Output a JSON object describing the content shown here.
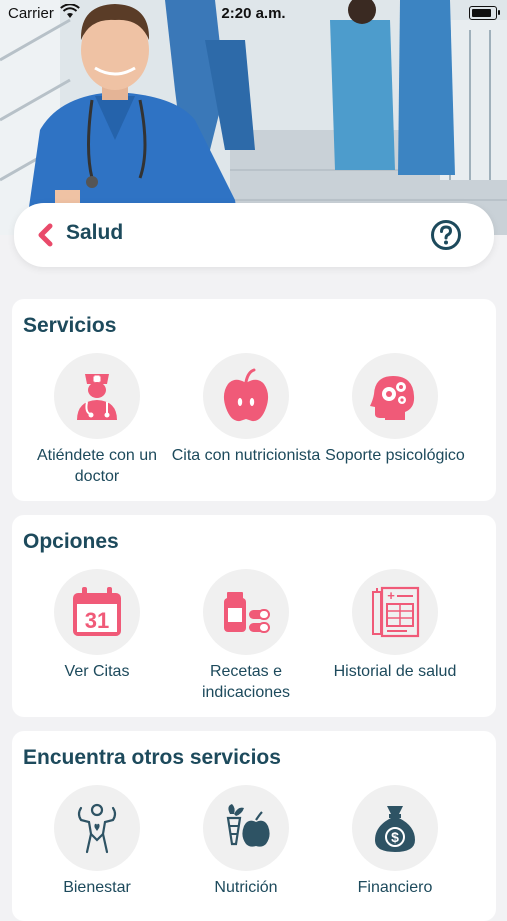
{
  "status_bar": {
    "carrier": "Carrier",
    "time": "2:20 a.m.",
    "battery_level": 0.95
  },
  "header": {
    "title": "Salud",
    "back_icon": "chevron-left-icon",
    "help_icon": "help-circle-icon"
  },
  "colors": {
    "accent": "#f0506e",
    "title": "#1d4a5c",
    "card": "#ffffff",
    "background": "#f2f2f4",
    "money": "#2e5364"
  },
  "sections": [
    {
      "title": "Servicios",
      "items": [
        {
          "label": "Atiéndete con un doctor",
          "icon": "nurse-icon"
        },
        {
          "label": "Cita con nutricionista",
          "icon": "apple-icon"
        },
        {
          "label": "Soporte psicológico",
          "icon": "head-gears-icon"
        }
      ]
    },
    {
      "title": "Opciones",
      "items": [
        {
          "label": "Ver Citas",
          "icon": "calendar-icon",
          "calendar_day": "31"
        },
        {
          "label": "Recetas e indicaciones",
          "icon": "medicine-icon"
        },
        {
          "label": "Historial de salud",
          "icon": "medical-record-icon",
          "record_mark": "+"
        }
      ]
    },
    {
      "title": "Encuentra otros servicios",
      "items": [
        {
          "label": "Bienestar",
          "icon": "wellness-person-icon"
        },
        {
          "label": "Nutrición",
          "icon": "vegetables-icon"
        },
        {
          "label": "Financiero",
          "icon": "money-bag-icon",
          "currency_symbol": "$"
        }
      ]
    }
  ]
}
